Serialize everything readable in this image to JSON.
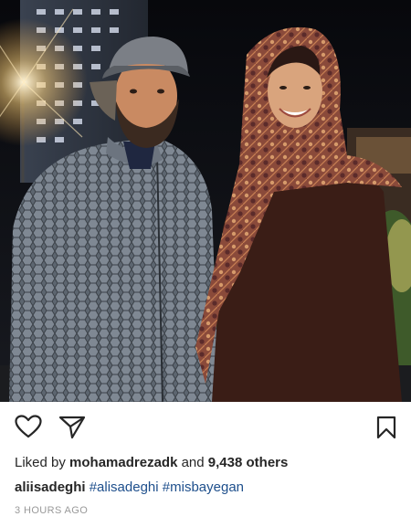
{
  "post": {
    "photo": {
      "description_icon": "photo"
    },
    "actions": {
      "like_icon": "heart-outline-icon",
      "share_icon": "paper-plane-icon",
      "save_icon": "bookmark-outline-icon"
    },
    "likes": {
      "prefix": "Liked by",
      "user": "mohamadrezadk",
      "middle": "and",
      "count_text": "9,438 others"
    },
    "caption": {
      "username": "aliisadeghi",
      "hashtags": [
        "#alisadeghi",
        "#misbayegan"
      ]
    },
    "timestamp": "3 HOURS AGO"
  },
  "colors": {
    "text": "#262626",
    "hashtag": "#1e4f8c",
    "timestamp": "#999999"
  }
}
